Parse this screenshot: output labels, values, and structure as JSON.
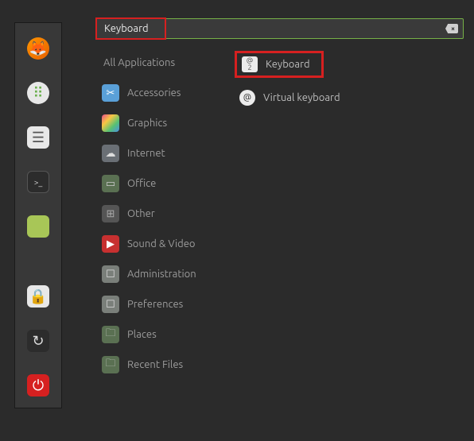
{
  "search": {
    "value": "Keyboard",
    "clear_glyph": "×"
  },
  "sidebar": {
    "items": [
      {
        "name": "firefox",
        "glyph": "🦊"
      },
      {
        "name": "apps",
        "glyph": "⠿"
      },
      {
        "name": "settings",
        "glyph": "☰"
      },
      {
        "name": "terminal",
        "glyph": ">_"
      },
      {
        "name": "files",
        "glyph": ""
      }
    ],
    "bottom": [
      {
        "name": "lock",
        "glyph": "🔒"
      },
      {
        "name": "logout",
        "glyph": "↻"
      },
      {
        "name": "power",
        "glyph": "⏻"
      }
    ]
  },
  "categories": [
    {
      "name": "all",
      "label": "All Applications",
      "icon": ""
    },
    {
      "name": "accessories",
      "label": "Accessories",
      "icon": "✂"
    },
    {
      "name": "graphics",
      "label": "Graphics",
      "icon": ""
    },
    {
      "name": "internet",
      "label": "Internet",
      "icon": "☁"
    },
    {
      "name": "office",
      "label": "Office",
      "icon": "▭"
    },
    {
      "name": "other",
      "label": "Other",
      "icon": "⊞"
    },
    {
      "name": "sound-video",
      "label": "Sound & Video",
      "icon": "▶"
    },
    {
      "name": "administration",
      "label": "Administration",
      "icon": "☐"
    },
    {
      "name": "preferences",
      "label": "Preferences",
      "icon": "☐"
    },
    {
      "name": "places",
      "label": "Places",
      "icon": "🗀"
    },
    {
      "name": "recent-files",
      "label": "Recent Files",
      "icon": "🗀"
    }
  ],
  "results": [
    {
      "name": "keyboard",
      "label": "Keyboard",
      "highlighted": true
    },
    {
      "name": "virtual-keyboard",
      "label": "Virtual keyboard",
      "highlighted": false
    }
  ],
  "highlight_color": "#d62020",
  "accent_color": "#76b047"
}
